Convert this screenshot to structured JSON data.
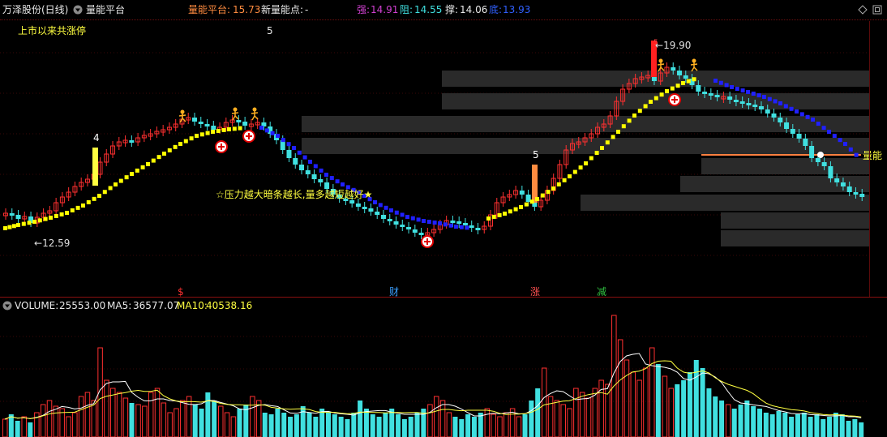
{
  "header": {
    "stock_title": "万泽股份(日线)",
    "indicator_name": "量能平台",
    "platform_label": "量能平台:",
    "platform_value": "15.73",
    "new_point_label": "新量能点:",
    "new_point_value": "-",
    "strong_label": "强:",
    "strong_value": "14.91",
    "resist_label": "阻:",
    "resist_value": "14.55",
    "support_label": "撑:",
    "support_value": "14.06",
    "bottom_label": "底:",
    "bottom_value": "13.93"
  },
  "main_panel": {
    "limit_up_text": "上市以来共涨停",
    "limit_up_count": "5",
    "high_label": "19.90",
    "low_label": "12.59",
    "annotation": "☆压力越大暗条越长,量多越短越好★",
    "right_label": "量能",
    "count_marks": [
      "4",
      "5",
      "5"
    ],
    "event_markers": [
      {
        "text": "$",
        "color": "#ff3030"
      },
      {
        "text": "财",
        "color": "#3aa0ff"
      },
      {
        "text": "涨",
        "color": "#ff5050"
      },
      {
        "text": "减",
        "color": "#30c040"
      }
    ]
  },
  "volume_panel": {
    "volume_label": "VOLUME:",
    "volume_value": "25553.00",
    "ma5_label": "MA5:",
    "ma5_value": "36577.07",
    "ma10_label": "MA10:",
    "ma10_value": "40538.16"
  },
  "colors": {
    "up": "#ff3030",
    "down": "#40e0e0",
    "ma_yellow": "#ffff00",
    "ma_blue": "#2020ff",
    "orange_line": "#ff8040",
    "title_orange": "#ff8c40",
    "strong_purple": "#d040d0",
    "bottom_blue": "#3060ff"
  },
  "icons": [
    "collapse-triangle-icon",
    "diamond-icon",
    "restore-window-icon",
    "close-icon",
    "buy-marker-icon",
    "runner-icon"
  ]
}
